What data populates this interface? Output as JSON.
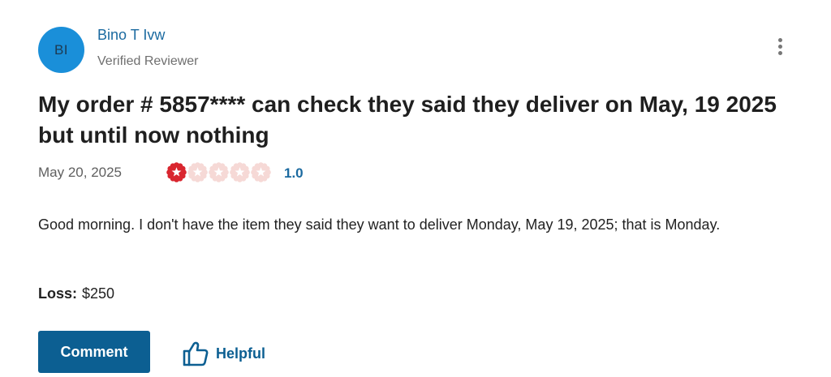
{
  "reviewer": {
    "initials": "BI",
    "name": "Bino T Ivw",
    "badge": "Verified Reviewer"
  },
  "review": {
    "title": "My order # 5857**** can check they said they deliver on May, 19 2025 but until now nothing",
    "date": "May 20, 2025",
    "rating": 1,
    "rating_max": 5,
    "rating_label": "1.0",
    "body": "Good morning. I don't have the item they said they want to deliver Monday, May 19, 2025; that is Monday.",
    "loss_label": "Loss:",
    "loss_amount": "$250"
  },
  "actions": {
    "comment_label": "Comment",
    "helpful_label": "Helpful"
  },
  "icons": {
    "menu": "more-vertical-icon",
    "star": "star-badge-icon",
    "helpful": "thumbs-up-icon"
  },
  "colors": {
    "avatar_bg": "#1a8fd9",
    "link": "#1b6aa0",
    "primary_button": "#0c5f92",
    "star_filled": "#d9262f",
    "star_empty": "#f6d9d6"
  }
}
